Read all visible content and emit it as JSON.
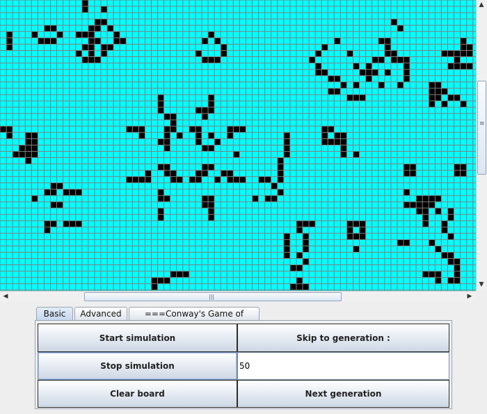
{
  "board": {
    "cell_color": "#00ffff",
    "grid_color": "#808080",
    "live_color": "#000000",
    "columns": 76,
    "rows": 46,
    "live_cells": [
      [
        13,
        0
      ],
      [
        13,
        1
      ],
      [
        16,
        1
      ],
      [
        15,
        3
      ],
      [
        16,
        3
      ],
      [
        62,
        3
      ],
      [
        7,
        4
      ],
      [
        8,
        4
      ],
      [
        14,
        4
      ],
      [
        15,
        4
      ],
      [
        17,
        4
      ],
      [
        63,
        4
      ],
      [
        1,
        5
      ],
      [
        5,
        5
      ],
      [
        9,
        5
      ],
      [
        12,
        5
      ],
      [
        13,
        5
      ],
      [
        14,
        5
      ],
      [
        18,
        5
      ],
      [
        33,
        5
      ],
      [
        1,
        6
      ],
      [
        6,
        6
      ],
      [
        7,
        6
      ],
      [
        8,
        6
      ],
      [
        14,
        6
      ],
      [
        15,
        6
      ],
      [
        18,
        6
      ],
      [
        19,
        6
      ],
      [
        32,
        6
      ],
      [
        34,
        6
      ],
      [
        53,
        6
      ],
      [
        60,
        6
      ],
      [
        61,
        6
      ],
      [
        73,
        6
      ],
      [
        1,
        7
      ],
      [
        13,
        7
      ],
      [
        14,
        7
      ],
      [
        16,
        7
      ],
      [
        17,
        7
      ],
      [
        35,
        7
      ],
      [
        51,
        7
      ],
      [
        61,
        7
      ],
      [
        73,
        7
      ],
      [
        74,
        7
      ],
      [
        12,
        8
      ],
      [
        14,
        8
      ],
      [
        16,
        8
      ],
      [
        31,
        8
      ],
      [
        35,
        8
      ],
      [
        50,
        8
      ],
      [
        55,
        8
      ],
      [
        61,
        8
      ],
      [
        62,
        8
      ],
      [
        70,
        8
      ],
      [
        71,
        8
      ],
      [
        72,
        8
      ],
      [
        73,
        8
      ],
      [
        74,
        8
      ],
      [
        13,
        9
      ],
      [
        14,
        9
      ],
      [
        15,
        9
      ],
      [
        32,
        9
      ],
      [
        33,
        9
      ],
      [
        34,
        9
      ],
      [
        49,
        9
      ],
      [
        59,
        9
      ],
      [
        60,
        9
      ],
      [
        62,
        9
      ],
      [
        63,
        9
      ],
      [
        64,
        9
      ],
      [
        72,
        9
      ],
      [
        50,
        10
      ],
      [
        56,
        10
      ],
      [
        58,
        10
      ],
      [
        64,
        10
      ],
      [
        71,
        10
      ],
      [
        72,
        10
      ],
      [
        73,
        10
      ],
      [
        74,
        10
      ],
      [
        50,
        11
      ],
      [
        51,
        11
      ],
      [
        57,
        11
      ],
      [
        58,
        11
      ],
      [
        59,
        11
      ],
      [
        61,
        11
      ],
      [
        64,
        11
      ],
      [
        52,
        12
      ],
      [
        53,
        12
      ],
      [
        58,
        12
      ],
      [
        64,
        12
      ],
      [
        54,
        13
      ],
      [
        56,
        13
      ],
      [
        60,
        13
      ],
      [
        63,
        13
      ],
      [
        68,
        13
      ],
      [
        69,
        13
      ],
      [
        52,
        14
      ],
      [
        53,
        14
      ],
      [
        68,
        14
      ],
      [
        69,
        14
      ],
      [
        70,
        14
      ],
      [
        25,
        15
      ],
      [
        33,
        15
      ],
      [
        55,
        15
      ],
      [
        56,
        15
      ],
      [
        57,
        15
      ],
      [
        68,
        15
      ],
      [
        69,
        15
      ],
      [
        71,
        15
      ],
      [
        72,
        15
      ],
      [
        25,
        16
      ],
      [
        33,
        16
      ],
      [
        68,
        16
      ],
      [
        70,
        16
      ],
      [
        73,
        16
      ],
      [
        25,
        17
      ],
      [
        31,
        17
      ],
      [
        32,
        17
      ],
      [
        33,
        17
      ],
      [
        26,
        18
      ],
      [
        27,
        18
      ],
      [
        32,
        18
      ],
      [
        27,
        19
      ],
      [
        0,
        20
      ],
      [
        1,
        20
      ],
      [
        20,
        20
      ],
      [
        21,
        20
      ],
      [
        22,
        20
      ],
      [
        26,
        20
      ],
      [
        27,
        20
      ],
      [
        30,
        20
      ],
      [
        31,
        20
      ],
      [
        36,
        20
      ],
      [
        37,
        20
      ],
      [
        38,
        20
      ],
      [
        51,
        20
      ],
      [
        52,
        20
      ],
      [
        1,
        21
      ],
      [
        4,
        21
      ],
      [
        5,
        21
      ],
      [
        22,
        21
      ],
      [
        26,
        21
      ],
      [
        28,
        21
      ],
      [
        31,
        21
      ],
      [
        33,
        21
      ],
      [
        36,
        21
      ],
      [
        45,
        21
      ],
      [
        51,
        21
      ],
      [
        53,
        21
      ],
      [
        54,
        21
      ],
      [
        4,
        22
      ],
      [
        5,
        22
      ],
      [
        25,
        22
      ],
      [
        26,
        22
      ],
      [
        31,
        22
      ],
      [
        34,
        22
      ],
      [
        45,
        22
      ],
      [
        51,
        22
      ],
      [
        52,
        22
      ],
      [
        53,
        22
      ],
      [
        54,
        22
      ],
      [
        3,
        23
      ],
      [
        4,
        23
      ],
      [
        5,
        23
      ],
      [
        26,
        23
      ],
      [
        32,
        23
      ],
      [
        33,
        23
      ],
      [
        45,
        23
      ],
      [
        54,
        23
      ],
      [
        2,
        24
      ],
      [
        3,
        24
      ],
      [
        4,
        24
      ],
      [
        5,
        24
      ],
      [
        37,
        24
      ],
      [
        45,
        24
      ],
      [
        54,
        24
      ],
      [
        56,
        24
      ],
      [
        4,
        25
      ],
      [
        44,
        25
      ],
      [
        25,
        26
      ],
      [
        26,
        26
      ],
      [
        32,
        26
      ],
      [
        33,
        26
      ],
      [
        44,
        26
      ],
      [
        64,
        26
      ],
      [
        65,
        26
      ],
      [
        72,
        26
      ],
      [
        73,
        26
      ],
      [
        23,
        27
      ],
      [
        26,
        27
      ],
      [
        27,
        27
      ],
      [
        31,
        27
      ],
      [
        32,
        27
      ],
      [
        35,
        27
      ],
      [
        36,
        27
      ],
      [
        44,
        27
      ],
      [
        64,
        27
      ],
      [
        65,
        27
      ],
      [
        72,
        27
      ],
      [
        73,
        27
      ],
      [
        20,
        28
      ],
      [
        21,
        28
      ],
      [
        22,
        28
      ],
      [
        23,
        28
      ],
      [
        27,
        28
      ],
      [
        28,
        28
      ],
      [
        30,
        28
      ],
      [
        31,
        28
      ],
      [
        34,
        28
      ],
      [
        36,
        28
      ],
      [
        37,
        28
      ],
      [
        38,
        28
      ],
      [
        41,
        28
      ],
      [
        42,
        28
      ],
      [
        44,
        28
      ],
      [
        8,
        29
      ],
      [
        9,
        29
      ],
      [
        43,
        29
      ],
      [
        7,
        30
      ],
      [
        8,
        30
      ],
      [
        10,
        30
      ],
      [
        11,
        30
      ],
      [
        12,
        30
      ],
      [
        25,
        30
      ],
      [
        44,
        30
      ],
      [
        64,
        30
      ],
      [
        5,
        31
      ],
      [
        25,
        31
      ],
      [
        26,
        31
      ],
      [
        32,
        31
      ],
      [
        33,
        31
      ],
      [
        40,
        31
      ],
      [
        42,
        31
      ],
      [
        43,
        31
      ],
      [
        66,
        31
      ],
      [
        67,
        31
      ],
      [
        68,
        31
      ],
      [
        69,
        31
      ],
      [
        8,
        32
      ],
      [
        9,
        32
      ],
      [
        32,
        32
      ],
      [
        33,
        32
      ],
      [
        64,
        32
      ],
      [
        65,
        32
      ],
      [
        66,
        32
      ],
      [
        67,
        32
      ],
      [
        68,
        32
      ],
      [
        25,
        33
      ],
      [
        33,
        33
      ],
      [
        66,
        33
      ],
      [
        67,
        33
      ],
      [
        69,
        33
      ],
      [
        71,
        33
      ],
      [
        25,
        34
      ],
      [
        33,
        34
      ],
      [
        67,
        34
      ],
      [
        71,
        34
      ],
      [
        7,
        35
      ],
      [
        8,
        35
      ],
      [
        10,
        35
      ],
      [
        11,
        35
      ],
      [
        12,
        35
      ],
      [
        47,
        35
      ],
      [
        48,
        35
      ],
      [
        49,
        35
      ],
      [
        55,
        35
      ],
      [
        56,
        35
      ],
      [
        57,
        35
      ],
      [
        67,
        35
      ],
      [
        70,
        35
      ],
      [
        7,
        36
      ],
      [
        47,
        36
      ],
      [
        55,
        36
      ],
      [
        57,
        36
      ],
      [
        70,
        36
      ],
      [
        45,
        37
      ],
      [
        48,
        37
      ],
      [
        55,
        37
      ],
      [
        56,
        37
      ],
      [
        57,
        37
      ],
      [
        71,
        37
      ],
      [
        45,
        38
      ],
      [
        48,
        38
      ],
      [
        63,
        38
      ],
      [
        64,
        38
      ],
      [
        68,
        38
      ],
      [
        45,
        39
      ],
      [
        48,
        39
      ],
      [
        56,
        39
      ],
      [
        69,
        39
      ],
      [
        45,
        40
      ],
      [
        47,
        40
      ],
      [
        70,
        40
      ],
      [
        71,
        40
      ],
      [
        48,
        41
      ],
      [
        71,
        41
      ],
      [
        72,
        41
      ],
      [
        46,
        42
      ],
      [
        47,
        42
      ],
      [
        72,
        42
      ],
      [
        27,
        43
      ],
      [
        28,
        43
      ],
      [
        29,
        43
      ],
      [
        67,
        43
      ],
      [
        68,
        43
      ],
      [
        69,
        43
      ],
      [
        72,
        43
      ],
      [
        24,
        44
      ],
      [
        25,
        44
      ],
      [
        26,
        44
      ],
      [
        47,
        44
      ],
      [
        69,
        44
      ],
      [
        71,
        44
      ],
      [
        72,
        44
      ],
      [
        24,
        45
      ],
      [
        46,
        45
      ],
      [
        47,
        45
      ],
      [
        48,
        45
      ]
    ]
  },
  "scrollbars": {
    "up_arrow": "▲",
    "down_arrow": "▼",
    "left_arrow": "◀",
    "right_arrow": "▶",
    "grip": "≡",
    "hgrip": "|||"
  },
  "tabs": [
    "Basic",
    "Advanced",
    "===Conway's Game of Life==="
  ],
  "controls": {
    "start_label": "Start simulation",
    "skip_label": "Skip to generation :",
    "stop_label": "Stop simulation",
    "generation_value": "50",
    "clear_label": "Clear board",
    "next_label": "Next generation"
  }
}
